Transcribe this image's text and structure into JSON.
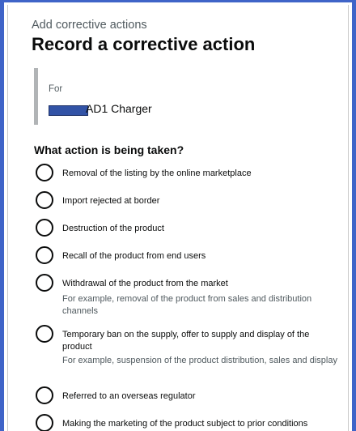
{
  "page": {
    "caption": "Add corrective actions",
    "title": "Record a corrective action"
  },
  "inset": {
    "for_label": "For",
    "product_name": "AD1 Charger"
  },
  "question": {
    "legend": "What action is being taken?",
    "options": [
      {
        "label": "Removal of the listing by the online marketplace",
        "hint": ""
      },
      {
        "label": "Import rejected at border",
        "hint": ""
      },
      {
        "label": "Destruction of the product",
        "hint": ""
      },
      {
        "label": "Recall of the product from end users",
        "hint": ""
      },
      {
        "label": "Withdrawal of the product from the market",
        "hint": "For example, removal of the product from sales and distribution channels"
      },
      {
        "label": "Temporary ban on the supply, offer to supply and display of the product",
        "hint": "For example, suspension of the product distribution, sales and display"
      },
      {
        "label": "Referred to an overseas regulator",
        "hint": ""
      },
      {
        "label": "Making the marketing of the product subject to prior conditions",
        "hint": ""
      }
    ]
  }
}
